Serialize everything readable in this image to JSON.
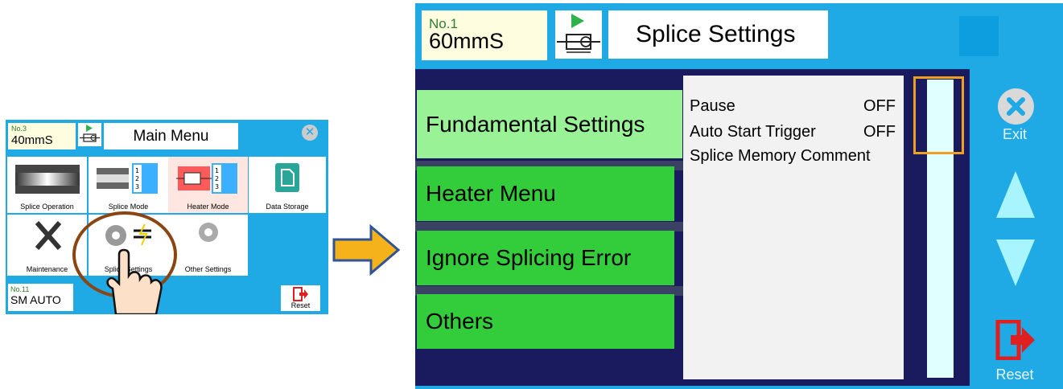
{
  "main_menu": {
    "program": {
      "number": "No.3",
      "name": "40mmS"
    },
    "title": "Main Menu",
    "tiles": [
      {
        "label": "Splice Operation"
      },
      {
        "label": "Splice Mode"
      },
      {
        "label": "Heater Mode"
      },
      {
        "label": "Data Storage"
      },
      {
        "label": "Maintenance"
      },
      {
        "label": "Splice Settings"
      },
      {
        "label": "Other Settings"
      }
    ],
    "heater_program": {
      "number": "No.11",
      "name": "SM AUTO"
    },
    "reset_label": "Reset"
  },
  "splice_settings": {
    "program": {
      "number": "No.1",
      "name": "60mmS"
    },
    "title": "Splice Settings",
    "menu_items": [
      {
        "label": "Fundamental Settings",
        "selected": true
      },
      {
        "label": "Heater Menu"
      },
      {
        "label": "Ignore Splicing Error"
      },
      {
        "label": "Others"
      }
    ],
    "settings": [
      {
        "name": "Pause",
        "value": "OFF"
      },
      {
        "name": "Auto Start Trigger",
        "value": "OFF"
      },
      {
        "name": "Splice Memory Comment",
        "value": ""
      }
    ],
    "side_buttons": {
      "exit": "Exit",
      "reset": "Reset"
    }
  },
  "colors": {
    "screen_bg": "#1fa9e5",
    "navy": "#1a1b5e",
    "menu_green": "#33cc3a",
    "menu_selected": "#99f296",
    "arrow": "#f5b21a"
  }
}
